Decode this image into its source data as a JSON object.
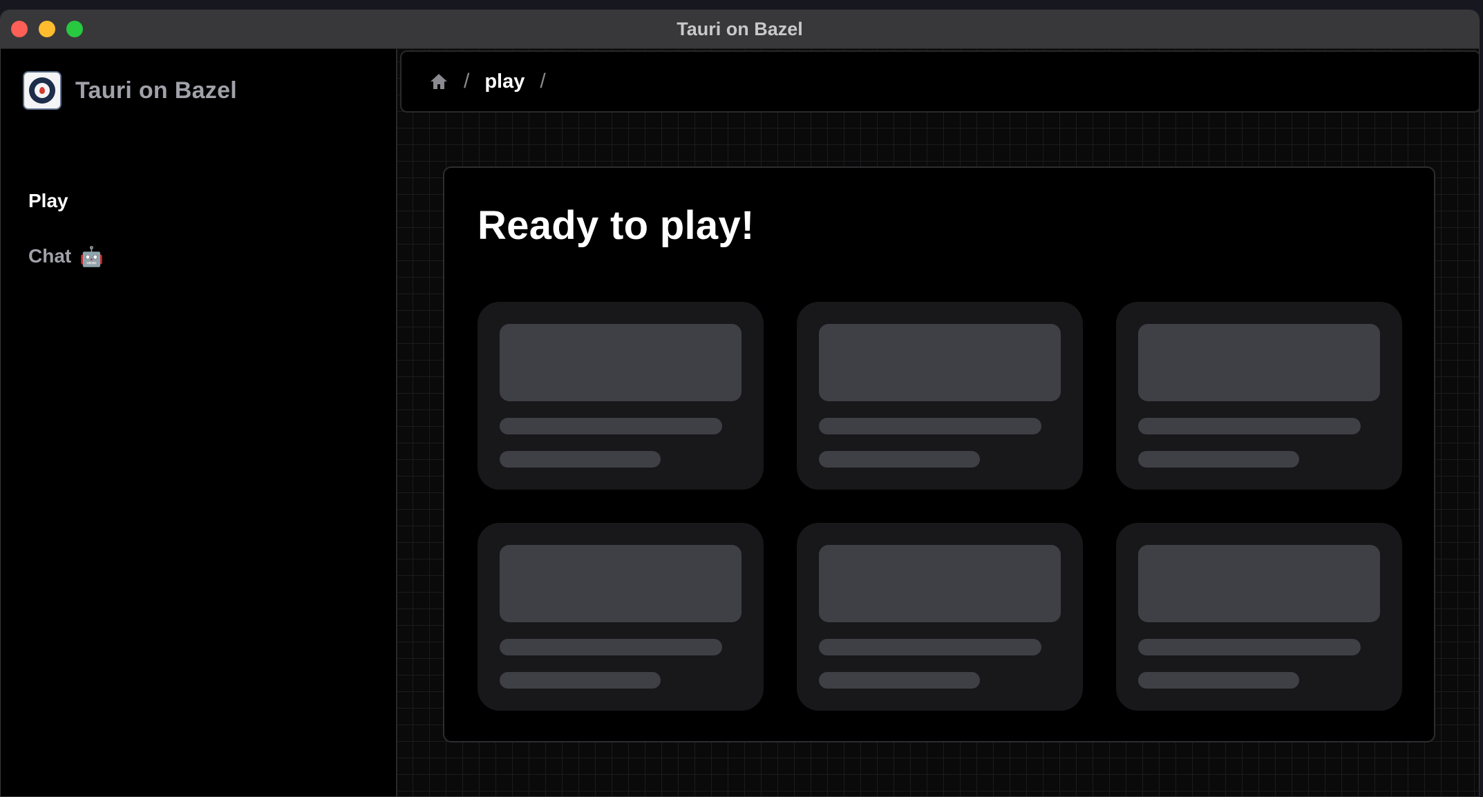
{
  "window": {
    "title": "Tauri on Bazel"
  },
  "sidebar": {
    "brand_name": "Tauri on Bazel",
    "items": [
      {
        "label": "Play",
        "emoji": "",
        "active": true
      },
      {
        "label": "Chat",
        "emoji": "🤖",
        "active": false
      }
    ]
  },
  "breadcrumb": {
    "home_icon": "home-icon",
    "separator": "/",
    "current": "play"
  },
  "main": {
    "heading": "Ready to play!",
    "skeleton_cards": 6
  },
  "colors": {
    "window_bg": "#000000",
    "titlebar_bg": "#38383a",
    "skeleton_card_bg": "#18181b",
    "skeleton_fill": "#3f3f46",
    "close": "#fe5f57",
    "minimize": "#febc2e",
    "maximize": "#28c840"
  }
}
